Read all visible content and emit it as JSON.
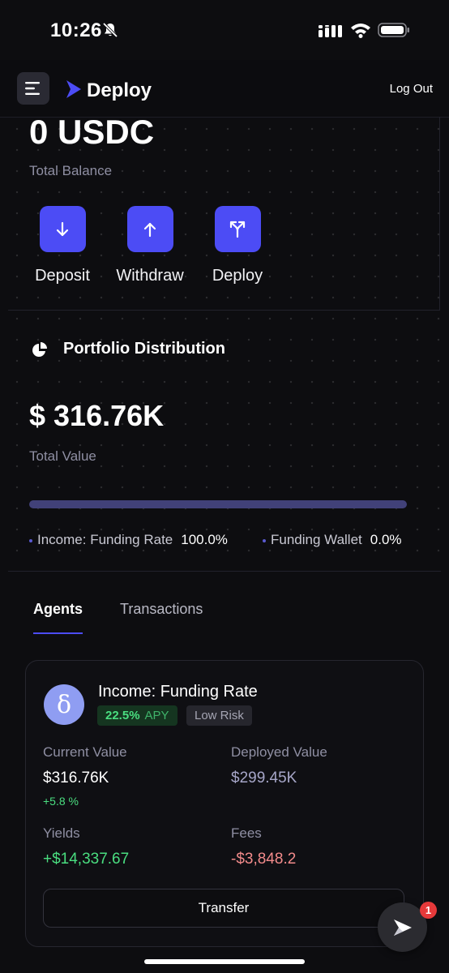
{
  "status_bar": {
    "time": "10:26"
  },
  "header": {
    "brand": "Deploy",
    "logout_label": "Log Out"
  },
  "balance": {
    "amount": "0 USDC",
    "label": "Total Balance",
    "actions": [
      {
        "label": "Deposit",
        "icon": "arrow-down-icon"
      },
      {
        "label": "Withdraw",
        "icon": "arrow-up-icon"
      },
      {
        "label": "Deploy",
        "icon": "split-arrows-icon"
      }
    ]
  },
  "portfolio": {
    "title": "Portfolio Distribution",
    "total_value": "$ 316.76K",
    "total_label": "Total Value",
    "bar_fill_fraction": 1.0,
    "legend": [
      {
        "name": "Income: Funding Rate",
        "percent": "100.0%"
      },
      {
        "name": "Funding Wallet",
        "percent": "0.0%"
      }
    ]
  },
  "tabs": [
    {
      "label": "Agents",
      "active": true
    },
    {
      "label": "Transactions",
      "active": false
    }
  ],
  "agent": {
    "avatar_glyph": "δ",
    "name": "Income: Funding Rate",
    "apy_value": "22.5%",
    "apy_unit": "APY",
    "risk": "Low Risk",
    "current_value_label": "Current Value",
    "current_value": "$316.76K",
    "current_change": "+5.8 %",
    "deployed_value_label": "Deployed Value",
    "deployed_value": "$299.45K",
    "yields_label": "Yields",
    "yields": "+$14,337.67",
    "fees_label": "Fees",
    "fees": "-$3,848.2",
    "transfer_label": "Transfer"
  },
  "fab": {
    "badge_count": "1"
  },
  "colors": {
    "accent": "#4c4cf5",
    "positive": "#4ade80",
    "negative": "#f28b8b",
    "background": "#0d0d10"
  }
}
